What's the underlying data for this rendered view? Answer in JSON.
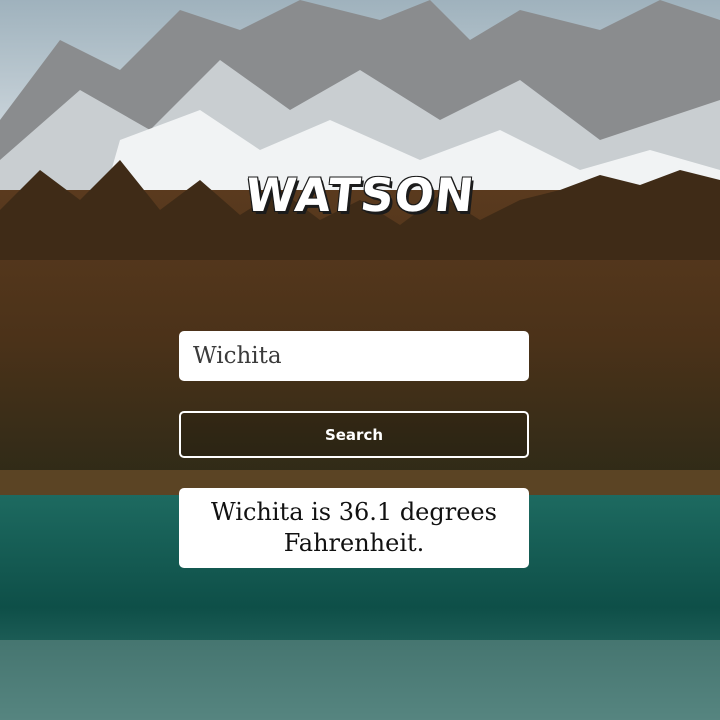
{
  "app": {
    "logo_text": "WATSON"
  },
  "search": {
    "value": "Wichita",
    "button_label": "Search"
  },
  "result": {
    "text": "Wichita is 36.1 degrees Fahrenheit."
  }
}
